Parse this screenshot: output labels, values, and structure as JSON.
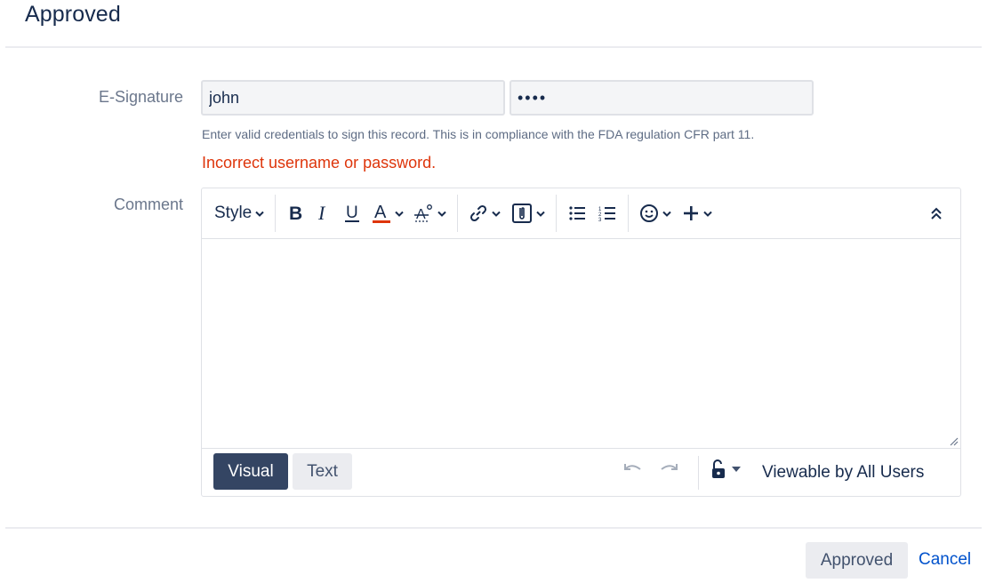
{
  "dialog": {
    "title": "Approved"
  },
  "esignature": {
    "label": "E-Signature",
    "username_value": "john",
    "password_value": "••••",
    "help": "Enter valid credentials to sign this record. This is in compliance with the FDA regulation CFR part 11.",
    "error": "Incorrect username or password."
  },
  "comment": {
    "label": "Comment",
    "toolbar": {
      "style_label": "Style",
      "icons": [
        "bold-icon",
        "italic-icon",
        "underline-icon",
        "text-color-icon",
        "text-format-icon",
        "link-icon",
        "attachment-icon",
        "bullet-list-icon",
        "numbered-list-icon",
        "emoji-icon",
        "plus-icon",
        "collapse-icon"
      ]
    },
    "modes": {
      "visual": "Visual",
      "text": "Text"
    },
    "visibility": "Viewable by All Users"
  },
  "actions": {
    "approve_label": "Approved",
    "cancel_label": "Cancel"
  },
  "colors": {
    "error": "#de350b",
    "link": "#0052cc",
    "active_mode": "#344563",
    "text_color_underline": "#de350b"
  }
}
